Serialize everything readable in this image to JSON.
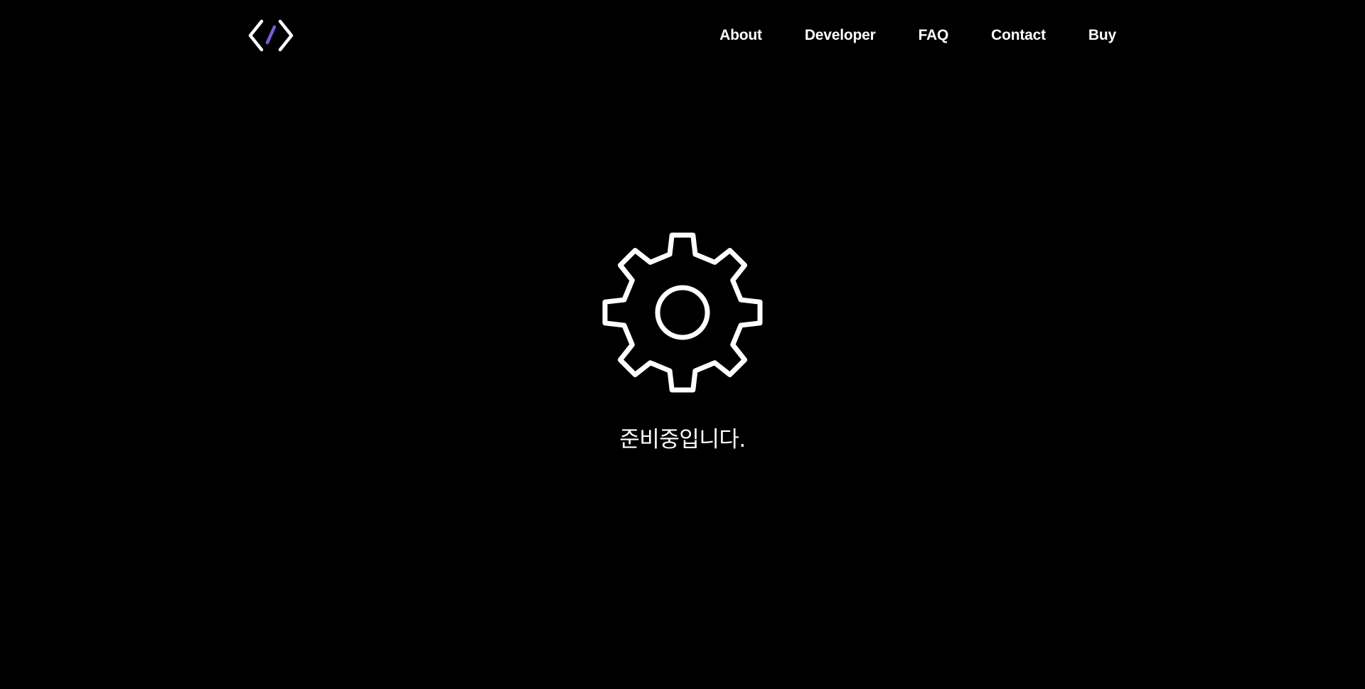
{
  "header": {
    "logo_icon": "code-brackets-icon",
    "nav": [
      {
        "label": "About"
      },
      {
        "label": "Developer"
      },
      {
        "label": "FAQ"
      },
      {
        "label": "Contact"
      },
      {
        "label": "Buy"
      }
    ]
  },
  "main": {
    "icon": "gear-icon",
    "message": "준비중입니다."
  },
  "colors": {
    "background": "#000000",
    "text": "#ffffff",
    "logo_accent": "#7b5cd6"
  }
}
